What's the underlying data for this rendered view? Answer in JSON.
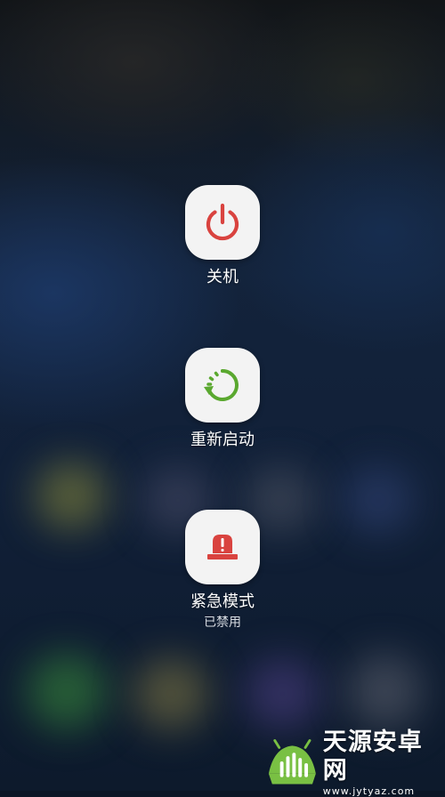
{
  "power_menu": {
    "items": [
      {
        "label": "关机",
        "icon": "power-icon",
        "color": "#d9433f"
      },
      {
        "label": "重新启动",
        "icon": "restart-icon",
        "color": "#5aa82f"
      },
      {
        "label": "紧急模式",
        "sublabel": "已禁用",
        "icon": "emergency-siren-icon",
        "color": "#d9433f"
      }
    ]
  },
  "watermark": {
    "title": "天源安卓网",
    "url": "www.jytyaz.com",
    "logo_color": "#79c043"
  },
  "colors": {
    "tile_background": "#f3f3f3",
    "label": "#ffffff"
  }
}
